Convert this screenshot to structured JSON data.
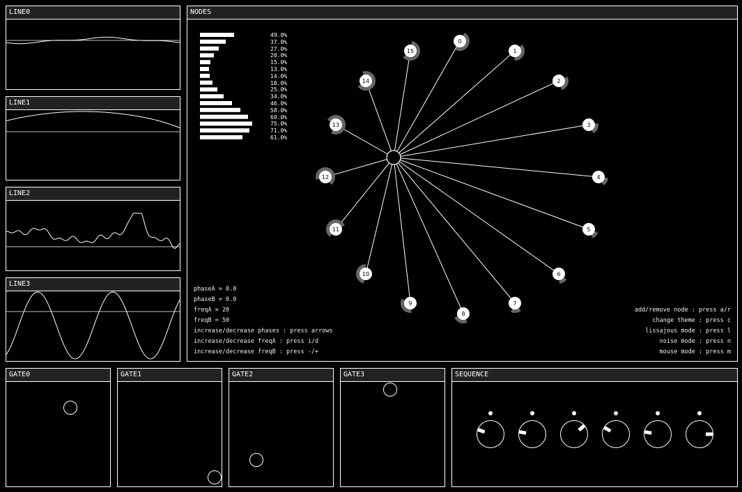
{
  "lines": [
    {
      "title": "LINE0"
    },
    {
      "title": "LINE1"
    },
    {
      "title": "LINE2"
    },
    {
      "title": "LINE3"
    }
  ],
  "nodes_panel": {
    "title": "NODES",
    "bar_labels": [
      "49.0%",
      "37.0%",
      "27.0%",
      "20.0%",
      "15.0%",
      "13.0%",
      "14.0%",
      "18.0%",
      "25.0%",
      "34.0%",
      "46.0%",
      "58.0%",
      "69.0%",
      "75.0%",
      "71.0%",
      "61.0%"
    ],
    "bar_values": [
      0.49,
      0.37,
      0.27,
      0.2,
      0.15,
      0.13,
      0.14,
      0.18,
      0.25,
      0.34,
      0.46,
      0.58,
      0.69,
      0.75,
      0.71,
      0.61
    ],
    "node_labels": [
      "0",
      "1",
      "2",
      "3",
      "4",
      "5",
      "6",
      "7",
      "8",
      "9",
      "10",
      "11",
      "12",
      "13",
      "14",
      "15"
    ],
    "info": [
      "phaseA = 0.0",
      "phaseB = 0.0",
      "freqA = 20",
      "freqB = 50",
      "increase/decrease phases : press arrows",
      "increase/decrease freqA : press i/d",
      "increase/decrease freqB : press -/+"
    ],
    "help": [
      "add/remove node : press a/r",
      "change theme : press c",
      "lissajous mode : press l",
      "noise mode : press n",
      "mouse mode : press m"
    ]
  },
  "gates": [
    {
      "title": "GATE0"
    },
    {
      "title": "GATE1"
    },
    {
      "title": "GATE2"
    },
    {
      "title": "GATE3"
    }
  ],
  "sequence": {
    "title": "SEQUENCE",
    "knob_count": 6
  },
  "colors": {
    "background": "#000000",
    "foreground": "#ffffff",
    "header": "#222222",
    "arc": "#666666"
  }
}
